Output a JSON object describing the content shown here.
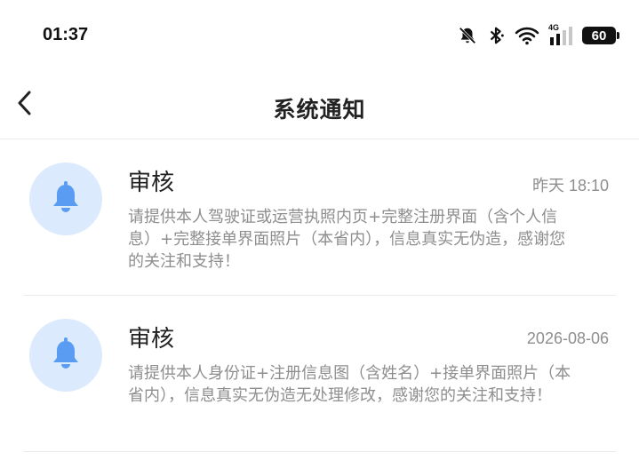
{
  "status_bar": {
    "time": "01:37",
    "network": "4G",
    "battery": "60",
    "icons": [
      "bell-off-icon",
      "bluetooth-icon",
      "wifi-icon",
      "signal-icon",
      "battery-icon"
    ]
  },
  "header": {
    "title": "系统通知",
    "back_icon": "chevron-left-icon"
  },
  "notices": [
    {
      "title": "审核",
      "time": "昨天 18:10",
      "body": "请提供本人驾驶证或运营执照内页+完整注册界面（含个人信息）+完整接单界面照片（本省内），信息真实无伪造，感谢您的关注和支持！",
      "icon": "bell-icon"
    },
    {
      "title": "审核",
      "time": "2026-08-06",
      "body": "请提供本人身份证+注册信息图（含姓名）+接单界面照片（本省内），信息真实无伪造无处理修改，感谢您的关注和支持！",
      "icon": "bell-icon"
    }
  ],
  "colors": {
    "bell": "#5a9cf2",
    "bell_bg": "#dceafd",
    "muted_text": "#8e8e8e",
    "divider": "#ececec"
  }
}
